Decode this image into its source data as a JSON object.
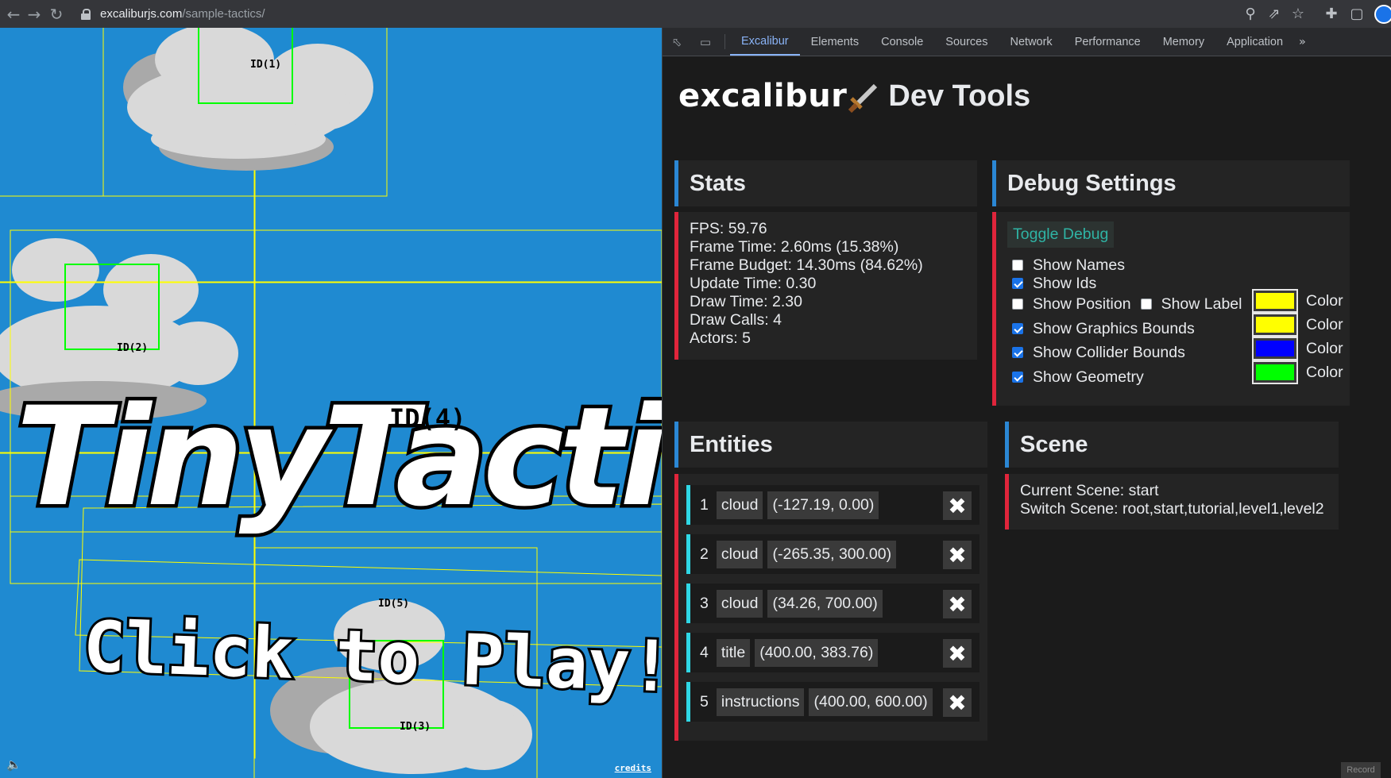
{
  "browser": {
    "url_host": "excaliburjs.com",
    "url_path": "/sample-tactics/"
  },
  "game": {
    "id_labels": [
      "ID(1)",
      "ID(2)",
      "ID(4)",
      "ID(5)",
      "ID(3)"
    ],
    "title_text": "TinyTactics",
    "subtitle_text": "Click to Play!",
    "credits": "credits"
  },
  "devtools": {
    "tabs": [
      "Excalibur",
      "Elements",
      "Console",
      "Sources",
      "Network",
      "Performance",
      "Memory",
      "Application"
    ],
    "brand_name": "excalibur",
    "brand_suffix": "Dev Tools",
    "stats": {
      "title": "Stats",
      "lines": [
        "FPS: 59.76",
        "Frame Time: 2.60ms (15.38%)",
        "Frame Budget: 14.30ms (84.62%)",
        "Update Time: 0.30",
        "Draw Time: 2.30",
        "Draw Calls: 4",
        "Actors: 5"
      ]
    },
    "debug": {
      "title": "Debug Settings",
      "toggle_label": "Toggle Debug",
      "show_names": "Show Names",
      "show_ids": "Show Ids",
      "show_position": "Show Position",
      "show_label": "Show Label",
      "show_graphics_bounds": "Show Graphics Bounds",
      "show_collider_bounds": "Show Collider Bounds",
      "show_geometry": "Show Geometry",
      "color_label": "Color",
      "colors": {
        "position": "#ffff00",
        "graphics": "#ffff00",
        "collider": "#0000ff",
        "geometry": "#00ff00"
      }
    },
    "entities": {
      "title": "Entities",
      "items": [
        {
          "id": "1",
          "name": "cloud",
          "pos": "(-127.19, 0.00)"
        },
        {
          "id": "2",
          "name": "cloud",
          "pos": "(-265.35, 300.00)"
        },
        {
          "id": "3",
          "name": "cloud",
          "pos": "(34.26, 700.00)"
        },
        {
          "id": "4",
          "name": "title",
          "pos": "(400.00, 383.76)"
        },
        {
          "id": "5",
          "name": "instructions",
          "pos": "(400.00, 600.00)"
        }
      ]
    },
    "scene": {
      "title": "Scene",
      "current": "Current Scene: start",
      "switch": "Switch Scene: root,start,tutorial,level1,level2"
    },
    "record_label": "Record"
  }
}
